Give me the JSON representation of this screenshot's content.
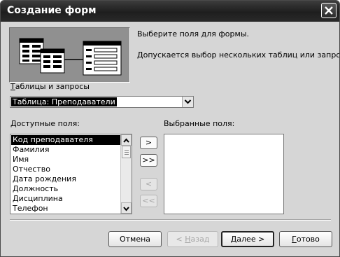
{
  "window": {
    "title": "Создание форм"
  },
  "intro": {
    "line1": "Выберите поля для формы.",
    "line2": "Допускается выбор нескольких таблиц или запросов."
  },
  "tables_section": {
    "label_mnemonic": "Т",
    "label_rest": "аблицы и запросы",
    "selected_value": "Таблица: Преподаватели"
  },
  "available_fields": {
    "label_mnemonic": "Д",
    "label_rest": "оступные поля:",
    "items": [
      "Код преподавателя",
      "Фамилия",
      "Имя",
      "Отчество",
      "Дата рождения",
      "Должность",
      "Дисциплина",
      "Телефон"
    ],
    "selected_index": 0
  },
  "selected_fields": {
    "label": "Выбранные поля:",
    "items": []
  },
  "move_buttons": {
    "add_one": ">",
    "add_all": ">>",
    "remove_one": "<",
    "remove_all": "<<"
  },
  "footer": {
    "cancel": "Отмена",
    "back_arrow": "< ",
    "back_mnemonic": "Н",
    "back_rest": "азад",
    "next_mnemonic": "Д",
    "next_rest": "алее >",
    "finish_mnemonic": "Г",
    "finish_rest": "отово"
  },
  "colors": {
    "titlebar": "#2a2a2a",
    "dialog_bg": "#d6d6d6",
    "selection": "#000000",
    "illustration_bg": "#909090"
  }
}
